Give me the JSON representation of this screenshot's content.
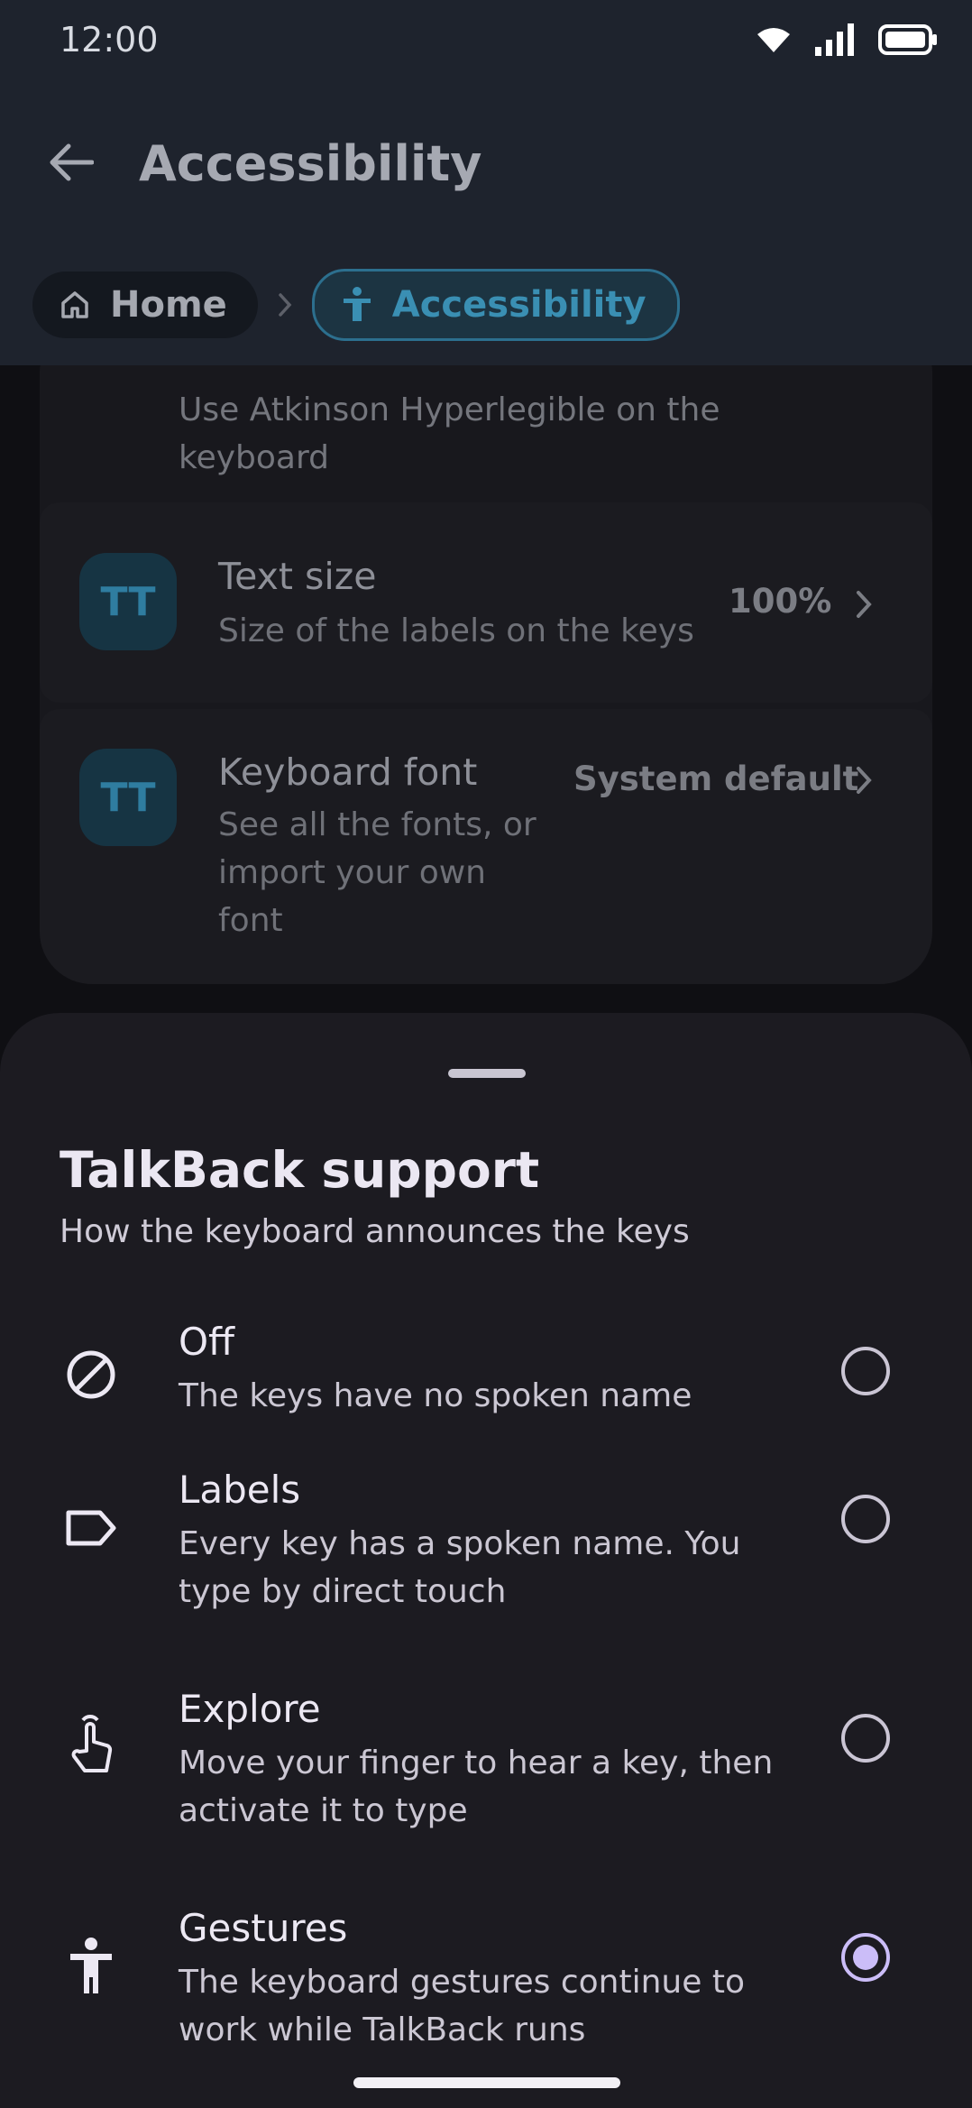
{
  "status": {
    "time": "12:00"
  },
  "header": {
    "title": "Accessibility"
  },
  "breadcrumbs": [
    {
      "label": "Home"
    },
    {
      "label": "Accessibility"
    }
  ],
  "settings": {
    "font_card_sub": "Use Atkinson Hyperlegible on the keyboard",
    "text_size": {
      "title": "Text size",
      "sub": "Size of the labels on the keys",
      "value": "100%",
      "icon_glyph": "TT"
    },
    "keyboard_font": {
      "title": "Keyboard font",
      "sub": "See all the fonts, or import your own font",
      "value": "System default",
      "icon_glyph": "TT"
    }
  },
  "sheet": {
    "title": "TalkBack support",
    "subtitle": "How the keyboard announces the keys",
    "options": [
      {
        "title": "Off",
        "sub": "The keys have no spoken name",
        "icon": "block-icon",
        "selected": false
      },
      {
        "title": "Labels",
        "sub": "Every key has a spoken name. You type by direct touch",
        "icon": "label-icon",
        "selected": false
      },
      {
        "title": "Explore",
        "sub": "Move your finger to hear a key, then activate it to type",
        "icon": "touch-icon",
        "selected": false
      },
      {
        "title": "Gestures",
        "sub": "The keyboard gestures continue to work while TalkBack runs",
        "icon": "accessibility-icon",
        "selected": true
      }
    ]
  },
  "colors": {
    "accent": "#cbbdf8",
    "chip_accent": "#3a8fb3",
    "sheet_bg": "#1c1b21"
  }
}
